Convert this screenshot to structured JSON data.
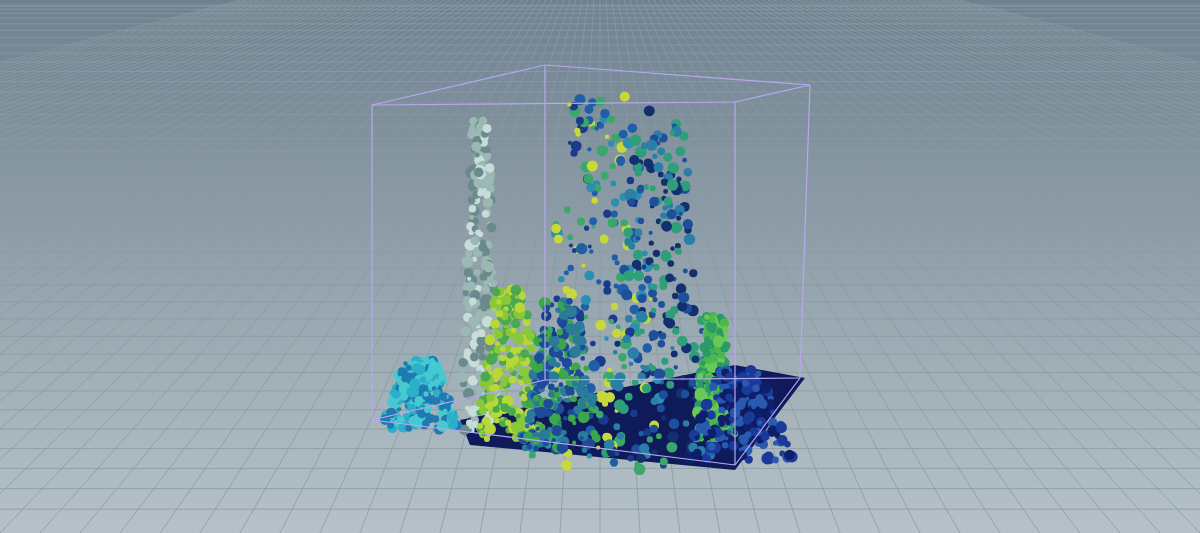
{
  "viewport": {
    "show_grid": true,
    "show_bounds": true
  }
}
